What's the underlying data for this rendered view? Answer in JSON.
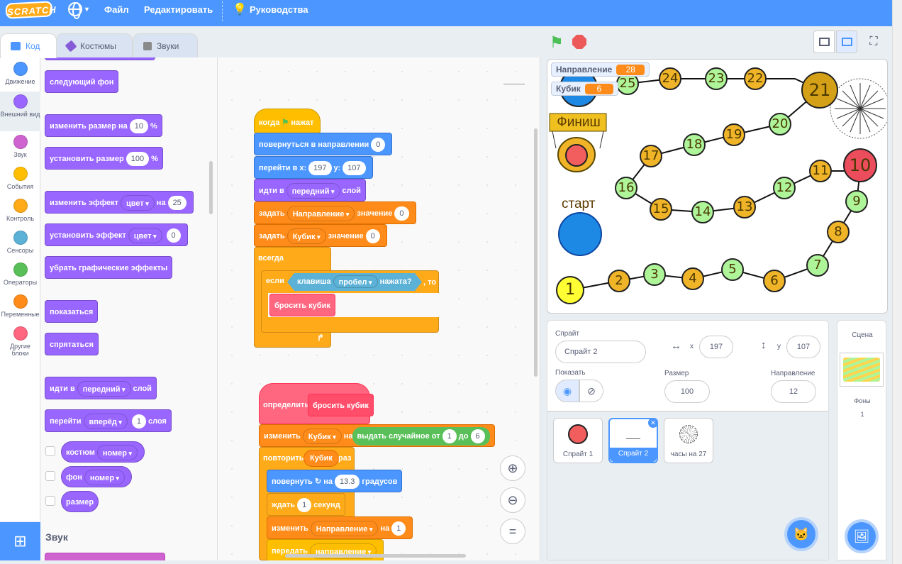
{
  "menu": {
    "logo": "SCRATCH",
    "file": "Файл",
    "edit": "Редактировать",
    "tutorials": "Руководства"
  },
  "tabs": {
    "code": "Код",
    "costumes": "Костюмы",
    "sounds": "Звуки"
  },
  "categories": [
    "Движение",
    "Внешний вид",
    "Звук",
    "События",
    "Контроль",
    "Сенсоры",
    "Операторы",
    "Переменные",
    "Другие блоки"
  ],
  "palette": {
    "next_backdrop": "следующий фон",
    "change_size": "изменить размер на",
    "change_size_val": "10",
    "pct": "%",
    "set_size": "установить размер",
    "set_size_val": "100",
    "change_effect": "изменить эффект",
    "effect": "цвет",
    "on": "на",
    "change_effect_val": "25",
    "set_effect": "установить эффект",
    "set_effect_val": "0",
    "clear_effects": "убрать графические эффекты",
    "show": "показаться",
    "hide": "спрятаться",
    "go_to_layer": "идти в",
    "layer_front": "передний",
    "layer": "слой",
    "go_layers": "перейти",
    "forward": "вперёд",
    "go_layers_val": "1",
    "layers": "слоя",
    "costume_rep": "костюм",
    "number": "номер",
    "backdrop_rep": "фон",
    "size_rep": "размер",
    "sound_heading": "Звук"
  },
  "script1": {
    "when_flag": "когда",
    "clicked": "нажат",
    "point_dir": "повернуться в направлении",
    "point_val": "0",
    "goto_xy": "перейти в x:",
    "x": "197",
    "y_lbl": "у:",
    "y": "107",
    "go_to": "идти в",
    "front": "передний",
    "layer": "слой",
    "set": "задать",
    "var_dir": "Направление",
    "to": "значение",
    "set_dir_val": "0",
    "var_cube": "Кубик",
    "set_cube_val": "0",
    "forever": "всегда",
    "if": "если",
    "key": "клавиша",
    "space": "пробел",
    "pressed": "нажата?",
    "then": ", то",
    "roll": "бросить кубик"
  },
  "script2": {
    "define": "определить",
    "roll": "бросить кубик",
    "change": "изменить",
    "var_cube": "Кубик",
    "by": "на",
    "random": "выдать случайное от",
    "from": "1",
    "to_lbl": "до",
    "to": "6",
    "repeat": "повторить",
    "times": "раз",
    "turn": "повернуть",
    "on": "на",
    "turn_val": "13.3",
    "degrees": "градусов",
    "wait": "ждать",
    "wait_val": "1",
    "seconds": "секунд",
    "var_dir": "Направление",
    "change_dir_val": "1",
    "broadcast": "передать",
    "msg": "направление"
  },
  "stage": {
    "monitors": [
      {
        "name": "Направление",
        "value": "28"
      },
      {
        "name": "Кубик",
        "value": "6"
      }
    ],
    "finish": "Финиш",
    "start": "старт",
    "cells": [
      "1",
      "2",
      "3",
      "4",
      "5",
      "6",
      "7",
      "8",
      "9",
      "10",
      "11",
      "12",
      "13",
      "14",
      "15",
      "16",
      "17",
      "18",
      "19",
      "20",
      "21",
      "22",
      "23",
      "24",
      "25"
    ]
  },
  "sprite_info": {
    "sprite_lbl": "Спрайт",
    "sprite_name": "Спрайт 2",
    "x_lbl": "x",
    "x": "197",
    "y_lbl": "y",
    "y": "107",
    "show_lbl": "Показать",
    "size_lbl": "Размер",
    "size": "100",
    "dir_lbl": "Направление",
    "dir": "12"
  },
  "sprites": [
    "Спрайт 1",
    "Спрайт 2",
    "часы на 27"
  ],
  "stage_panel": {
    "title": "Сцена",
    "backdrops_lbl": "Фоны",
    "backdrops_count": "1"
  },
  "colors": {
    "motion": "#4c97ff",
    "looks": "#9966ff",
    "sound": "#cf63cf",
    "events": "#ffbf00",
    "control": "#ffab19",
    "sensing": "#5cb1d6",
    "operators": "#59c059",
    "variables": "#ff8c1a",
    "myblocks": "#ff6680"
  }
}
